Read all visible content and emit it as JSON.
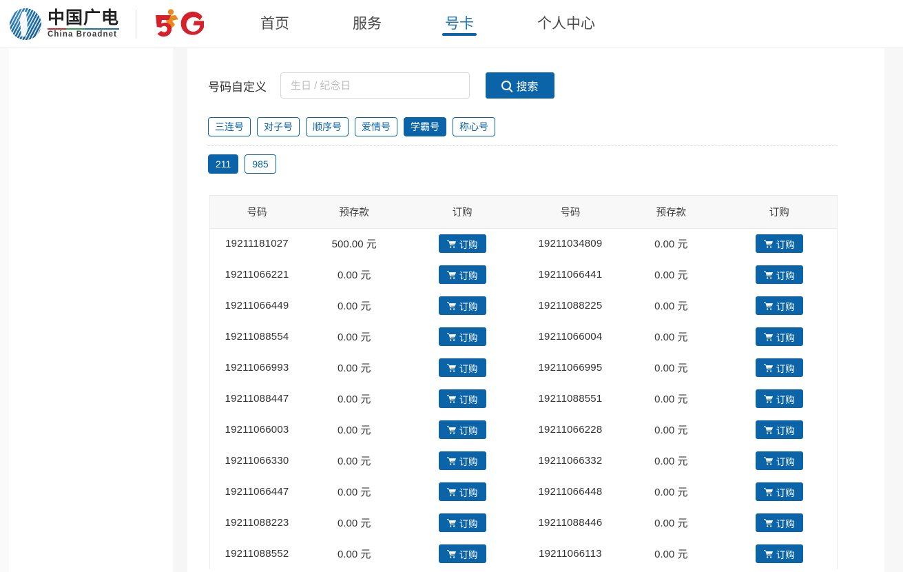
{
  "header": {
    "brand": {
      "logo_icon": "china-broadnet-globe-icon",
      "name_cn": "中国广电",
      "name_en": "China Broadnet",
      "badge_icon": "5g-logo-icon",
      "badge_text": "5G"
    },
    "nav": [
      {
        "label": "首页",
        "active": false
      },
      {
        "label": "服务",
        "active": false
      },
      {
        "label": "号卡",
        "active": true
      },
      {
        "label": "个人中心",
        "active": false
      }
    ]
  },
  "search": {
    "label": "号码自定义",
    "placeholder": "生日 / 纪念日",
    "value": "",
    "button_label": "搜索",
    "button_icon": "search-icon"
  },
  "filters": {
    "tags": [
      {
        "label": "三连号",
        "selected": false
      },
      {
        "label": "对子号",
        "selected": false
      },
      {
        "label": "顺序号",
        "selected": false
      },
      {
        "label": "爱情号",
        "selected": false
      },
      {
        "label": "学霸号",
        "selected": true
      },
      {
        "label": "称心号",
        "selected": false
      }
    ],
    "subtags": [
      {
        "label": "211",
        "selected": true
      },
      {
        "label": "985",
        "selected": false
      }
    ]
  },
  "table": {
    "headers": [
      "号码",
      "预存款",
      "订购",
      "号码",
      "预存款",
      "订购"
    ],
    "order_button_label": "订购",
    "order_button_icon": "shopping-cart-icon",
    "rows": [
      {
        "left_number": "19211181027",
        "left_deposit": "500.00 元",
        "right_number": "19211034809",
        "right_deposit": "0.00 元"
      },
      {
        "left_number": "19211066221",
        "left_deposit": "0.00 元",
        "right_number": "19211066441",
        "right_deposit": "0.00 元"
      },
      {
        "left_number": "19211066449",
        "left_deposit": "0.00 元",
        "right_number": "19211088225",
        "right_deposit": "0.00 元"
      },
      {
        "left_number": "19211088554",
        "left_deposit": "0.00 元",
        "right_number": "19211066004",
        "right_deposit": "0.00 元"
      },
      {
        "left_number": "19211066993",
        "left_deposit": "0.00 元",
        "right_number": "19211066995",
        "right_deposit": "0.00 元"
      },
      {
        "left_number": "19211088447",
        "left_deposit": "0.00 元",
        "right_number": "19211088551",
        "right_deposit": "0.00 元"
      },
      {
        "left_number": "19211066003",
        "left_deposit": "0.00 元",
        "right_number": "19211066228",
        "right_deposit": "0.00 元"
      },
      {
        "left_number": "19211066330",
        "left_deposit": "0.00 元",
        "right_number": "19211066332",
        "right_deposit": "0.00 元"
      },
      {
        "left_number": "19211066447",
        "left_deposit": "0.00 元",
        "right_number": "19211066448",
        "right_deposit": "0.00 元"
      },
      {
        "left_number": "19211088223",
        "left_deposit": "0.00 元",
        "right_number": "19211088446",
        "right_deposit": "0.00 元"
      },
      {
        "left_number": "19211088552",
        "left_deposit": "0.00 元",
        "right_number": "19211066113",
        "right_deposit": "0.00 元"
      }
    ]
  },
  "colors": {
    "primary": "#0b64a8",
    "nav_active": "#1a73b7",
    "table_header_bg": "#f8f8f8",
    "border": "#ececec"
  }
}
